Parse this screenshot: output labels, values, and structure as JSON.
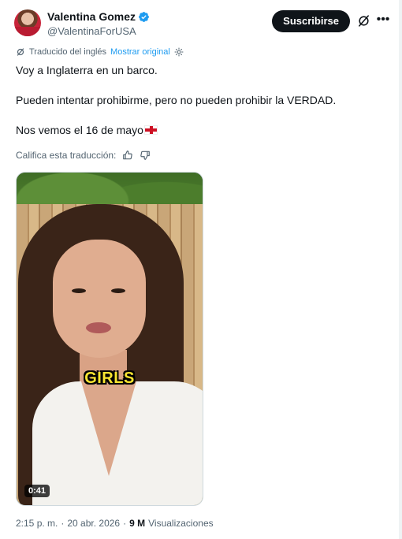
{
  "author": {
    "display_name": "Valentina Gomez",
    "handle": "@ValentinaForUSA",
    "verified": true
  },
  "actions": {
    "subscribe_label": "Suscribirse",
    "grok_icon": "grok-icon",
    "more_icon": "more-icon"
  },
  "translation": {
    "notice": "Traducido del inglés",
    "show_original": "Mostrar original",
    "rate_label": "Califica esta traducción:"
  },
  "tweet": {
    "lines": [
      "Voy a Inglaterra en un barco.",
      "Pueden intentar prohibirme, pero no pueden prohibir la VERDAD.",
      "Nos vemos el 16 de mayo"
    ],
    "flag": "england-flag"
  },
  "video": {
    "caption": "GIRLS",
    "duration": "0:41"
  },
  "meta": {
    "time": "2:15 p. m.",
    "separator": "·",
    "date": "20 abr. 2026",
    "views_count": "9 M",
    "views_label": "Visualizaciones"
  },
  "colors": {
    "link": "#1d9bf0",
    "muted": "#536471",
    "text": "#0f1419",
    "caption": "#f9e531"
  }
}
